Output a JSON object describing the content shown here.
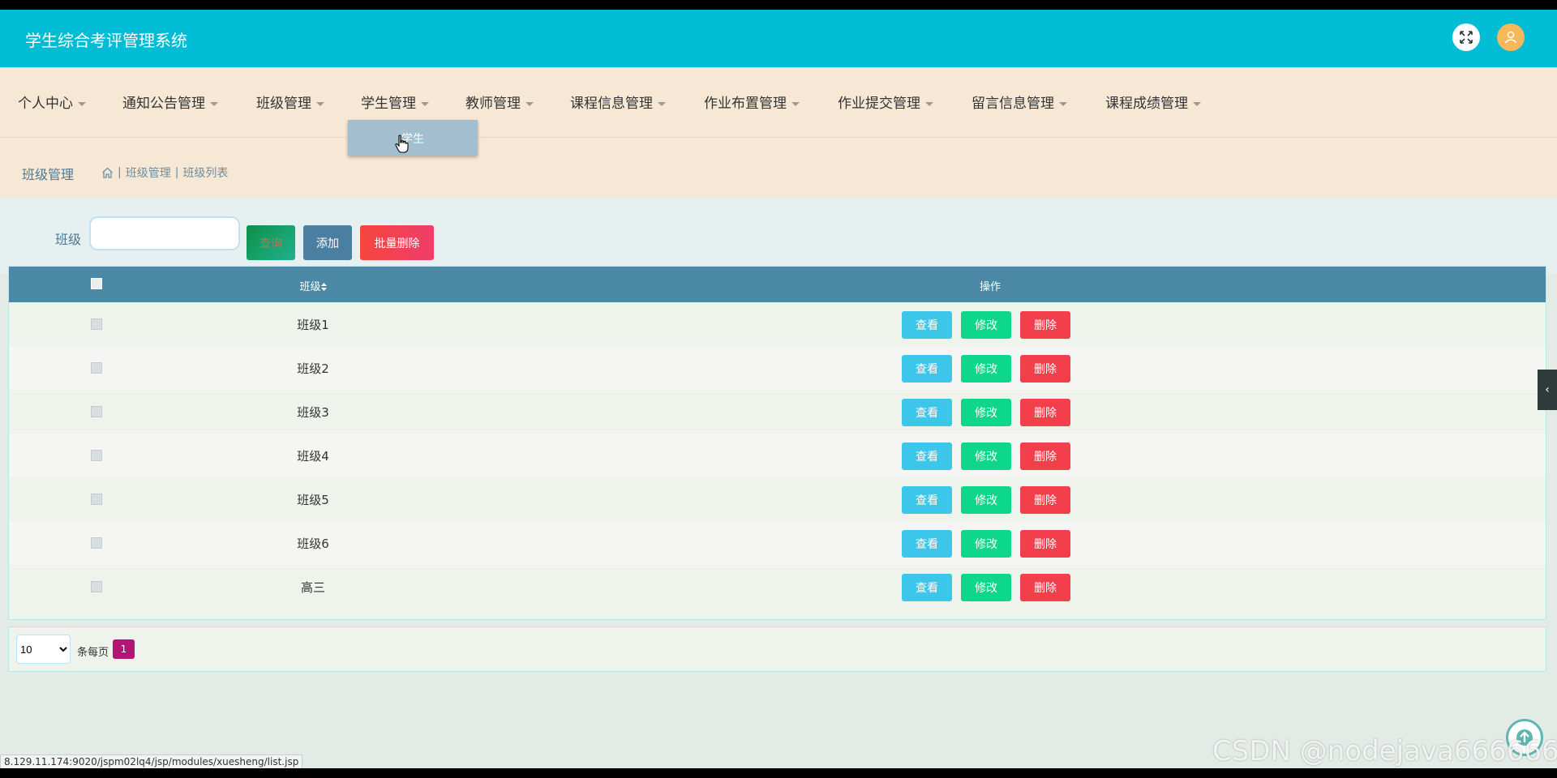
{
  "header": {
    "title": "学生综合考评管理系统"
  },
  "nav": {
    "items": [
      "个人中心",
      "通知公告管理",
      "班级管理",
      "学生管理",
      "教师管理",
      "课程信息管理",
      "作业布置管理",
      "作业提交管理",
      "留言信息管理",
      "课程成绩管理"
    ],
    "dropdown_item": "学生"
  },
  "breadcrumb": {
    "title": "班级管理",
    "path": [
      "班级管理",
      "班级列表"
    ]
  },
  "search": {
    "label": "班级",
    "query_label": "查询",
    "add_label": "添加",
    "batch_delete_label": "批量删除"
  },
  "table": {
    "headers": {
      "name": "班级",
      "ops": "操作"
    },
    "rows": [
      "班级1",
      "班级2",
      "班级3",
      "班级4",
      "班级5",
      "班级6",
      "高三"
    ],
    "view_label": "查看",
    "edit_label": "修改",
    "delete_label": "删除"
  },
  "pagination": {
    "page_size": "10",
    "per_page_label": "条每页",
    "current_page": "1"
  },
  "status_url": "8.129.11.174:9020/jspm02lq4/jsp/modules/xuesheng/list.jsp",
  "watermark": "CSDN @nodejava666666",
  "colors": {
    "header": "#00bcd4",
    "nav": "#f7e8d6",
    "table_head": "#4a88a6",
    "view": "#3cc6ea",
    "edit": "#0ed68a",
    "delete": "#f33e4b"
  }
}
